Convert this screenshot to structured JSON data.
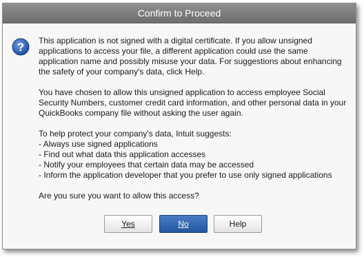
{
  "dialog": {
    "title": "Confirm to Proceed",
    "icon": "question-icon",
    "paragraph1": "This application is not signed with a digital certificate.  If you allow unsigned applications to access your file, a different application could use the same application name and possibly misuse your data.  For suggestions about enhancing the safety of your company's data, click Help.",
    "paragraph2": "You have chosen to allow this unsigned application to access employee Social Security Numbers, customer credit card information, and other personal data in your QuickBooks company file without asking the user again.",
    "suggest_intro": "To help protect your company's data, Intuit suggests:",
    "suggestions": [
      "- Always use signed applications",
      "- Find out what data this application accesses",
      "- Notify your employees that certain data may be accessed",
      "- Inform the application developer that you prefer to use only signed applications"
    ],
    "question": "Are you sure you want to allow this access?"
  },
  "buttons": {
    "yes_label": "Yes",
    "no_label": "No",
    "help_label": "Help"
  },
  "colors": {
    "titlebar": "#7a7a7a",
    "primary_button": "#2f63ad",
    "icon_blue": "#2b5fb0"
  }
}
